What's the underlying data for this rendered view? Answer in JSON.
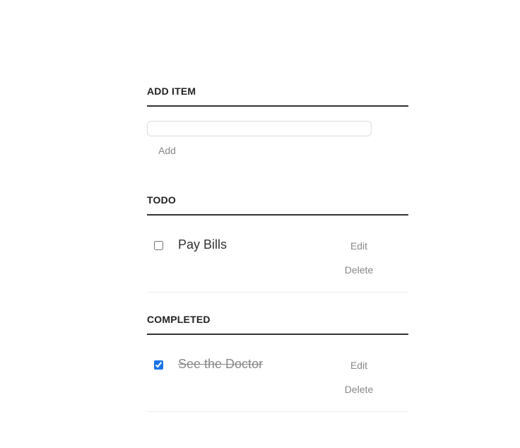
{
  "add_section": {
    "title": "ADD ITEM",
    "input_value": "",
    "input_placeholder": "",
    "add_label": "Add"
  },
  "todo_section": {
    "title": "TODO",
    "items": [
      {
        "label": "Pay Bills",
        "checked": false,
        "edit_label": "Edit",
        "delete_label": "Delete"
      }
    ]
  },
  "completed_section": {
    "title": "COMPLETED",
    "items": [
      {
        "label": "See the Doctor",
        "checked": true,
        "edit_label": "Edit",
        "delete_label": "Delete"
      }
    ]
  },
  "colors": {
    "heading_text": "#222222",
    "divider": "#333333",
    "muted_text": "#888888",
    "checkbox_accent": "#1a73e8"
  }
}
